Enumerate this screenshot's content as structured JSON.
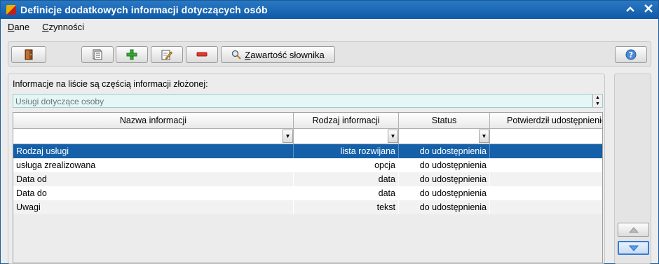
{
  "window": {
    "title": "Definicje dodatkowych informacji dotyczących osób",
    "controls": {
      "collapse": "^",
      "close": "✕"
    }
  },
  "menu": [
    {
      "label": "Dane",
      "accel": "D",
      "rest": "ane"
    },
    {
      "label": "Czynności",
      "accel": "C",
      "rest": "zynności"
    }
  ],
  "toolbar": {
    "exit_icon": "door-exit-icon",
    "list_icon": "document-list-icon",
    "add_icon": "green-plus-icon",
    "edit_icon": "edit-pencil-icon",
    "delete_icon": "red-minus-icon",
    "dictionary_icon": "magnifier-icon",
    "dictionary_label": "Zawartość słownika",
    "help_icon": "question-mark-icon"
  },
  "main": {
    "info_label": "Informacje na liście są częścią informacji złożonej:",
    "composite_value": "Usługi dotyczące osoby",
    "columns": [
      "Nazwa informacji",
      "Rodzaj informacji",
      "Status",
      "Potwierdził udostępnienie"
    ],
    "rows": [
      {
        "name": "Rodzaj usługi",
        "type": "lista rozwijana",
        "status": "do udostępnienia",
        "confirmed": ""
      },
      {
        "name": "usługa zrealizowana",
        "type": "opcja",
        "status": "do udostępnienia",
        "confirmed": ""
      },
      {
        "name": "Data od",
        "type": "data",
        "status": "do udostępnienia",
        "confirmed": ""
      },
      {
        "name": "Data do",
        "type": "data",
        "status": "do udostępnienia",
        "confirmed": ""
      },
      {
        "name": "Uwagi",
        "type": "tekst",
        "status": "do udostępnienia",
        "confirmed": ""
      }
    ],
    "selected_row": 0
  },
  "side": {
    "up_icon": "arrow-up-icon",
    "down_icon": "arrow-down-icon"
  },
  "colors": {
    "titlebar": "#1a6bb8",
    "selection": "#1560a8",
    "combo_bg": "#e4f6f6"
  }
}
